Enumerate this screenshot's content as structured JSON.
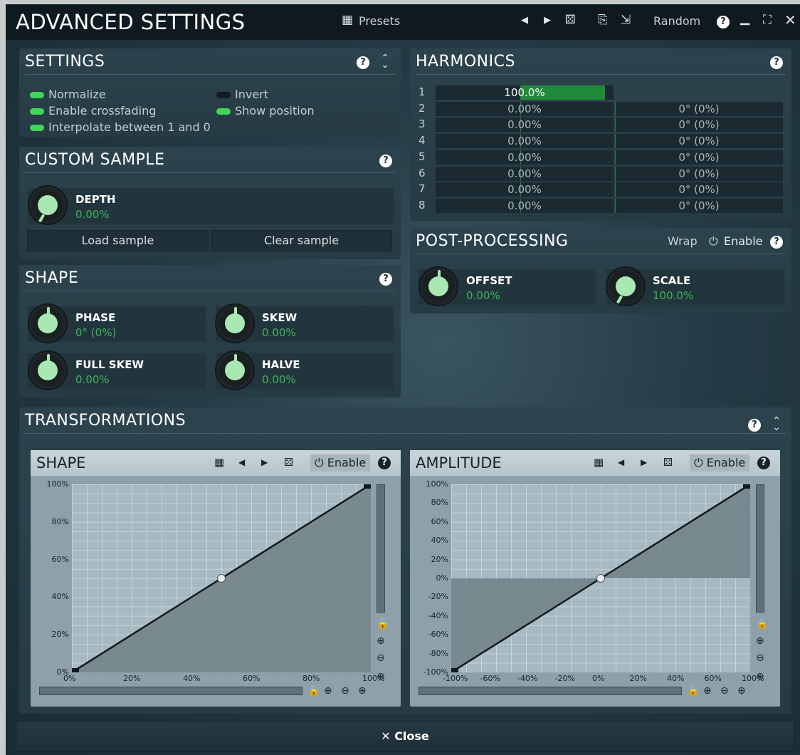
{
  "window": {
    "title": "ADVANCED SETTINGS",
    "presets_label": "Presets",
    "random_label": "Random"
  },
  "settings": {
    "title": "SETTINGS",
    "toggles": [
      {
        "label": "Normalize",
        "on": true
      },
      {
        "label": "Enable crossfading",
        "on": true
      },
      {
        "label": "Interpolate between 1 and 0",
        "on": true
      },
      {
        "label": "Invert",
        "on": false
      },
      {
        "label": "Show position",
        "on": true
      }
    ]
  },
  "custom_sample": {
    "title": "CUSTOM SAMPLE",
    "depth_label": "DEPTH",
    "depth_value": "0.00%",
    "load_label": "Load sample",
    "clear_label": "Clear sample"
  },
  "shape": {
    "title": "SHAPE",
    "knobs": [
      {
        "label": "PHASE",
        "value": "0° (0%)"
      },
      {
        "label": "SKEW",
        "value": "0.00%"
      },
      {
        "label": "FULL SKEW",
        "value": "0.00%"
      },
      {
        "label": "HALVE",
        "value": "0.00%"
      }
    ]
  },
  "harmonics": {
    "title": "HARMONICS",
    "rows": [
      {
        "n": "1",
        "amp": "100.0%",
        "phase": "",
        "amp_level": 1.0
      },
      {
        "n": "2",
        "amp": "0.00%",
        "phase": "0° (0%)",
        "amp_level": 0
      },
      {
        "n": "3",
        "amp": "0.00%",
        "phase": "0° (0%)",
        "amp_level": 0
      },
      {
        "n": "4",
        "amp": "0.00%",
        "phase": "0° (0%)",
        "amp_level": 0
      },
      {
        "n": "5",
        "amp": "0.00%",
        "phase": "0° (0%)",
        "amp_level": 0
      },
      {
        "n": "6",
        "amp": "0.00%",
        "phase": "0° (0%)",
        "amp_level": 0
      },
      {
        "n": "7",
        "amp": "0.00%",
        "phase": "0° (0%)",
        "amp_level": 0
      },
      {
        "n": "8",
        "amp": "0.00%",
        "phase": "0° (0%)",
        "amp_level": 0
      }
    ]
  },
  "post_processing": {
    "title": "POST-PROCESSING",
    "wrap_label": "Wrap",
    "enable_label": "Enable",
    "offset_label": "OFFSET",
    "offset_value": "0.00%",
    "scale_label": "SCALE",
    "scale_value": "100.0%"
  },
  "transformations": {
    "title": "TRANSFORMATIONS",
    "shape_graph": {
      "title": "SHAPE",
      "enable_label": "Enable",
      "y_ticks": [
        "100%",
        "80%",
        "60%",
        "40%",
        "20%",
        "0%"
      ],
      "x_ticks": [
        "0%",
        "20%",
        "40%",
        "60%",
        "80%",
        "100%"
      ]
    },
    "amplitude_graph": {
      "title": "AMPLITUDE",
      "enable_label": "Enable",
      "y_ticks": [
        "100%",
        "80%",
        "60%",
        "40%",
        "20%",
        "0%",
        "-20%",
        "-40%",
        "-60%",
        "-80%",
        "-100%"
      ],
      "x_ticks": [
        "-100%",
        "-60%",
        "-40%",
        "-20%",
        "0%",
        "20%",
        "40%",
        "60%",
        "100%"
      ]
    }
  },
  "footer": {
    "close_label": "Close"
  },
  "colors": {
    "accent_green": "#41d65a",
    "value_green": "#3fb25a",
    "bar_green": "#1e8a3a"
  }
}
